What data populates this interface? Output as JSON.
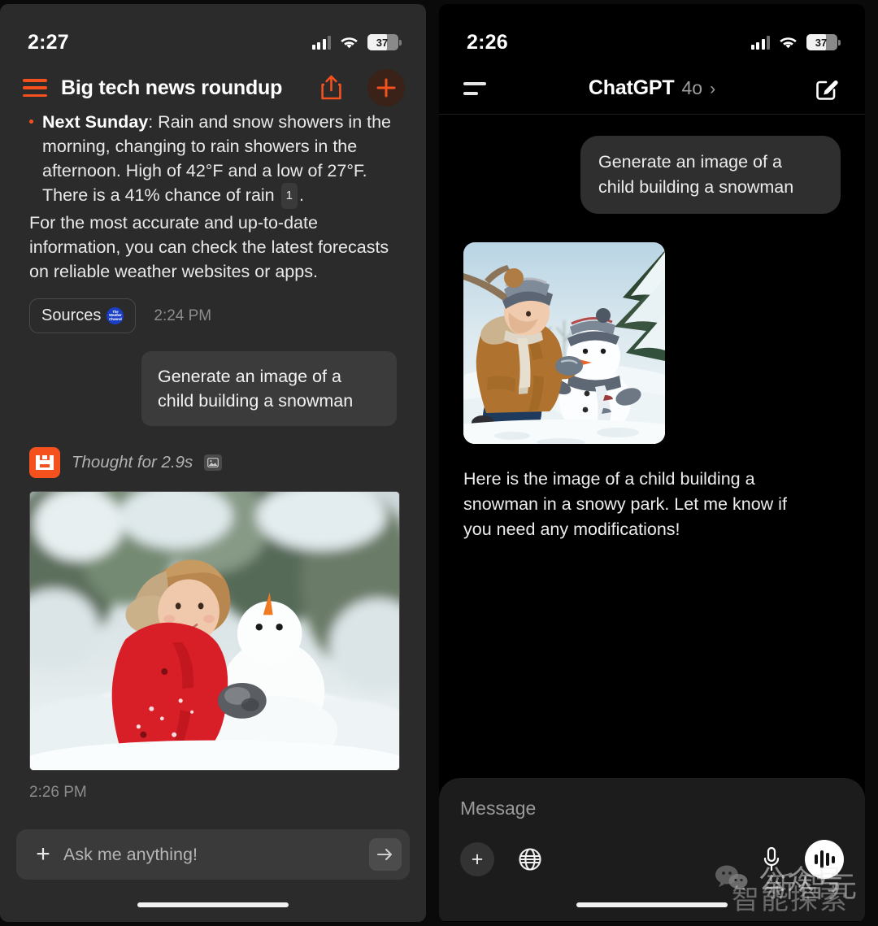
{
  "left_phone": {
    "status": {
      "time": "2:27",
      "battery_level": "37",
      "wifi": "wifi-icon",
      "signal": "cellular-icon"
    },
    "header": {
      "menu_icon": "hamburger-menu-icon",
      "title": "Big tech news roundup",
      "share_icon": "share-icon",
      "new_icon": "plus-icon"
    },
    "conversation": {
      "bullet_label": "Next Sunday",
      "bullet_text": ": Rain and snow showers in the morning, changing to rain showers in the afternoon. High of 42°F and a low of 27°F. There is a 41% chance of rain",
      "citation": "1",
      "bullet_tail": ".",
      "paragraph": "For the most accurate and up-to-date information, you can check the latest forecasts on reliable weather websites or apps.",
      "sources_label": "Sources",
      "sources_logo": "the-weather-channel-logo",
      "sources_time": "2:24 PM",
      "user_message": "Generate an image of a child building a snowman",
      "thought_status": "Thought for 2.9s",
      "thought_badge_icon": "image-icon",
      "assistant_app_icon": "assistant-app-icon",
      "image_alt": "Child in red coat building a snowman in snowy forest",
      "image_time": "2:26 PM"
    },
    "composer": {
      "add_icon": "plus-icon",
      "placeholder": "Ask me anything!",
      "send_icon": "arrow-right-icon"
    }
  },
  "right_phone": {
    "status": {
      "time": "2:26",
      "battery_level": "37",
      "wifi": "wifi-icon",
      "signal": "cellular-icon"
    },
    "header": {
      "sidebar_icon": "sidebar-toggle-icon",
      "brand": "ChatGPT",
      "model": "4o",
      "chevron": "›",
      "new_chat_icon": "compose-icon"
    },
    "conversation": {
      "user_message": "Generate an image of a child building a snowman",
      "image_alt": "Child in brown coat kneeling beside a snowman with knit hat and scarf in a snowy park",
      "assistant_message": "Here is the image of a child building a snowman in a snowy park. Let me know if you need any modifications!"
    },
    "composer": {
      "placeholder": "Message",
      "add_icon": "plus-icon",
      "globe_icon": "globe-icon",
      "mic_icon": "microphone-icon",
      "voice_icon": "voice-mode-icon"
    }
  },
  "watermark": {
    "wechat_icon": "wechat-logo",
    "text": "公众号",
    "text2": "新智元",
    "text3": "智能探索"
  },
  "colors": {
    "accent_orange": "#f4511e",
    "left_bg": "#2b2b2b",
    "right_bg": "#000000",
    "bubble_left": "#3b3b3b",
    "bubble_right": "#2f2f2f"
  }
}
